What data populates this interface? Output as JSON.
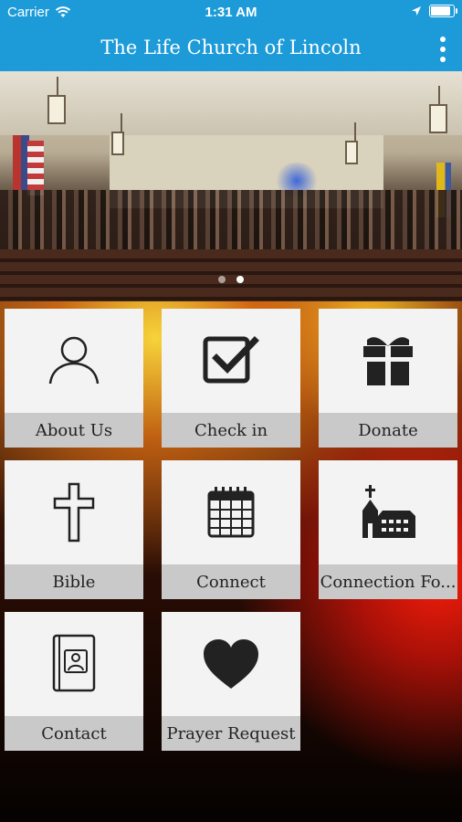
{
  "status_bar": {
    "carrier": "Carrier",
    "time": "1:31 AM",
    "battery_level": 0.95
  },
  "header": {
    "title": "The Life Church of Lincoln"
  },
  "carousel": {
    "page_count": 2,
    "active_index": 1
  },
  "tiles": [
    {
      "label": "About Us",
      "icon": "person-icon"
    },
    {
      "label": "Check in",
      "icon": "checkbox-icon"
    },
    {
      "label": "Donate",
      "icon": "gift-icon"
    },
    {
      "label": "Bible",
      "icon": "cross-icon"
    },
    {
      "label": "Connect",
      "icon": "calendar-icon"
    },
    {
      "label": "Connection Fo...",
      "icon": "church-icon"
    },
    {
      "label": "Contact",
      "icon": "contact-book-icon"
    },
    {
      "label": "Prayer Request",
      "icon": "heart-icon"
    }
  ],
  "colors": {
    "accent": "#1d9bd8",
    "tile_bg": "#f3f3f3",
    "tile_label_bg": "#c9c9c9"
  }
}
